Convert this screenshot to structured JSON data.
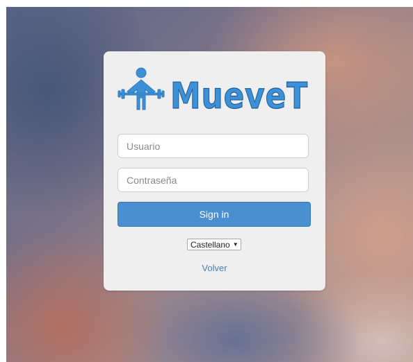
{
  "brand": {
    "name": "MueveT",
    "logo_icon": "weightlifter-icon",
    "color": "#3d8fd6"
  },
  "login": {
    "username_placeholder": "Usuario",
    "password_placeholder": "Contraseña",
    "signin_label": "Sign in",
    "language_selected": "Castellano",
    "back_label": "Volver"
  },
  "colors": {
    "button": "#4a8fd0",
    "card": "#efefef",
    "link": "#4a7fb5"
  }
}
